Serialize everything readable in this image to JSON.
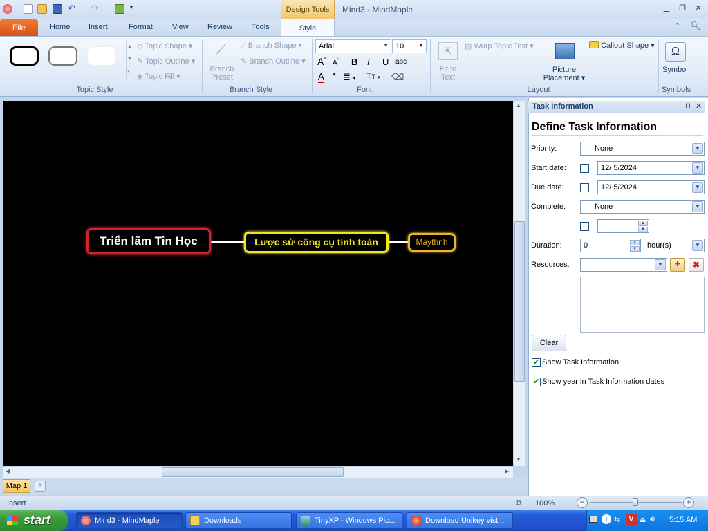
{
  "window": {
    "title": "Mind3 - MindMaple",
    "contextual_group": "Design Tools"
  },
  "tabs": [
    "File",
    "Home",
    "Insert",
    "Format",
    "View",
    "Review",
    "Tools",
    "Style"
  ],
  "ribbon": {
    "topic_style": {
      "label": "Topic Style",
      "topic_shape": "Topic Shape",
      "topic_outline": "Topic Outline",
      "topic_fill": "Topic Fill"
    },
    "branch_style": {
      "label": "Branch Style",
      "branch_preset": "Branch Preset",
      "branch_shape": "Branch Shape",
      "branch_outline": "Branch Outline"
    },
    "font": {
      "label": "Font",
      "family": "Arial",
      "size": "10",
      "bold": "B",
      "italic": "I",
      "underline": "U",
      "strike": "abc"
    },
    "layout": {
      "label": "Layout",
      "fit_to_text": "Fit to Text",
      "wrap_topic_text": "Wrap Topic Text",
      "picture_placement": "Picture Placement",
      "callout_shape": "Callout Shape"
    },
    "symbols": {
      "label": "Symbols",
      "symbol": "Symbol"
    }
  },
  "map": {
    "central_topic": "Triển lãm Tin Học",
    "subtopic": "Lược sử công cụ tính toán",
    "leaf_topic": "Máythnh",
    "sheet_tab": "Map 1"
  },
  "task_panel": {
    "title": "Task Information",
    "heading": "Define Task Information",
    "priority_label": "Priority:",
    "priority_value": "None",
    "start_label": "Start date:",
    "start_value": "12/  5/2024",
    "due_label": "Due date:",
    "due_value": "12/  5/2024",
    "complete_label": "Complete:",
    "complete_value": "None",
    "duration_label": "Duration:",
    "duration_value": "0",
    "duration_unit": "hour(s)",
    "resources_label": "Resources:",
    "clear_button": "Clear",
    "show_task_info": "Show Task Information",
    "show_year": "Show year in Task Information dates"
  },
  "status": {
    "mode": "Insert",
    "zoom": "100%"
  },
  "taskbar": {
    "start": "start",
    "items": [
      "Mind3 - MindMaple",
      "Downloads",
      "TinyXP - Windows Pic...",
      "Download Unikey vist..."
    ],
    "clock": "5:15 AM"
  },
  "colors": {
    "central_border": "#d2202c",
    "subtopic_border": "#f4e51a",
    "leaf_border": "#f0b427",
    "canvas_bg": "#000000",
    "file_tab": "#e0641f"
  }
}
